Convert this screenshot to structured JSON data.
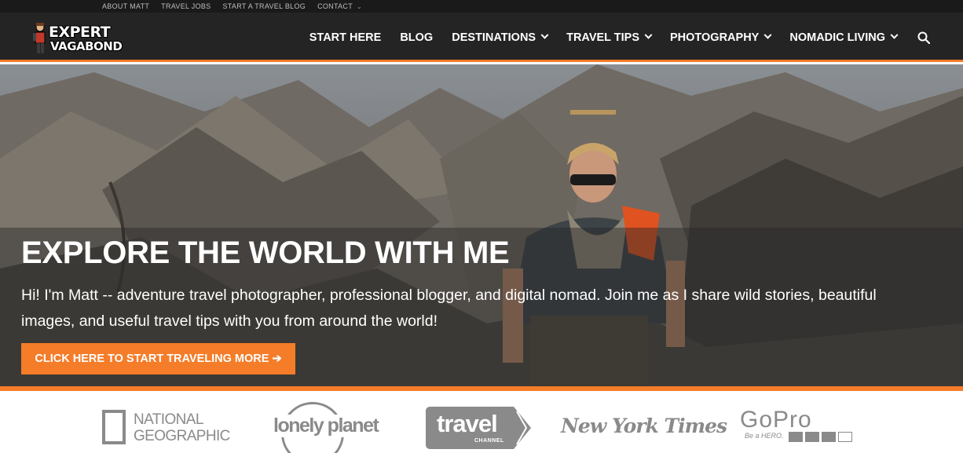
{
  "topbar": {
    "links": [
      "ABOUT MATT",
      "TRAVEL JOBS",
      "START A TRAVEL BLOG",
      "CONTACT"
    ]
  },
  "brand": {
    "line1": "EXPERT",
    "line2": "VAGABOND"
  },
  "nav": {
    "items": [
      {
        "label": "START HERE",
        "dropdown": false
      },
      {
        "label": "BLOG",
        "dropdown": false
      },
      {
        "label": "DESTINATIONS",
        "dropdown": true
      },
      {
        "label": "TRAVEL TIPS",
        "dropdown": true
      },
      {
        "label": "PHOTOGRAPHY",
        "dropdown": true
      },
      {
        "label": "NOMADIC LIVING",
        "dropdown": true
      }
    ],
    "search_icon": "search-icon"
  },
  "hero": {
    "title": "EXPLORE THE WORLD WITH ME",
    "text": "Hi! I'm Matt -- adventure travel photographer, professional blogger, and digital nomad. Join me as I share wild stories, beautiful images, and useful travel tips with you from around the world!",
    "cta": "CLICK HERE TO START TRAVELING MORE ➔"
  },
  "press": {
    "natgeo": [
      "NATIONAL",
      "GEOGRAPHIC"
    ],
    "lonely": "lonely planet",
    "travel": "travel",
    "travel_sub": "CHANNEL",
    "nyt": "New York Times",
    "gopro": "GoPro",
    "gopro_tag": "Be a HERO."
  },
  "colors": {
    "accent": "#f57c28",
    "nav_bg": "#242424",
    "topbar_bg": "#1a1a1a"
  }
}
